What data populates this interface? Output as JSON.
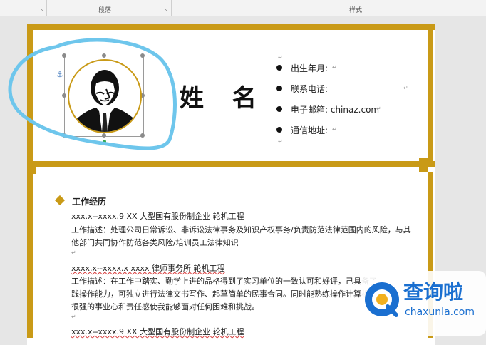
{
  "ribbon": {
    "paragraph_label": "段落",
    "styles_label": "样式"
  },
  "resume": {
    "name": "姓 名",
    "info": [
      {
        "label": "出生年月:"
      },
      {
        "label": "联系电话:"
      },
      {
        "label": "电子邮箱: chinaz.com"
      },
      {
        "label": "通信地址:"
      }
    ],
    "section_title": "工作经历",
    "lines": [
      "xxx.x--xxxx.9          XX 大型国有股份制企业       轮机工程",
      "工作描述：处理公司日常诉讼、非诉讼法律事务及知识产权事务/负责防范法律范围内的风险，与其",
      "他部门共同协作防范各类风险/培训员工法律知识",
      "xxxx.x--xxxx.x          xxxx 律师事务所             轮机工程",
      "工作描述：在工作中踏实、勤学上进的品格得到了实习单位的一致认可和好评，己具备了",
      "践操作能力，可独立进行法律文书写作、起草简单的民事合同。同时能熟练操作计算机办",
      "很强的事业心和责任感使我能够面对任何困难和挑战。",
      "xxx.x--xxxx.9          XX 大型国有股份制企业       轮机工程"
    ]
  },
  "watermark": {
    "brand": "查询啦",
    "url": "chaxunla.com"
  },
  "colors": {
    "gold": "#c99a17",
    "annotation_blue": "#6ec6ec",
    "watermark_blue": "#1a6fd0"
  }
}
